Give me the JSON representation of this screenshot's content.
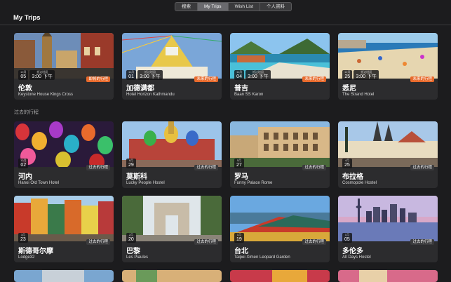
{
  "tabs": [
    {
      "label": "搜索"
    },
    {
      "label": "My Trips",
      "active": true
    },
    {
      "label": "Wish List"
    },
    {
      "label": "个人资料"
    }
  ],
  "page_title": "My Trips",
  "past_section_label": "过去的行程",
  "accent_color": "#e86a2c",
  "upcoming": [
    {
      "city": "伦敦",
      "hotel": "Keystone House Kings Cross",
      "month": "10月",
      "day": "05",
      "time_label": "抵达时间",
      "time": "3:00 下午",
      "badge": "即将的行程",
      "photo": "london-street"
    },
    {
      "city": "加德满都",
      "hotel": "Hotel Horizon Kathmandu",
      "month": "11月",
      "day": "01",
      "time_label": "抵达时间",
      "time": "3:00 下午",
      "badge": "未来的行程",
      "photo": "kathmandu-stupa"
    },
    {
      "city": "普吉",
      "hotel": "Baan SS Karon",
      "month": "11月",
      "day": "04",
      "time_label": "抵达时间",
      "time": "3:00 下午",
      "badge": "未来的行程",
      "photo": "phuket-pool"
    },
    {
      "city": "悉尼",
      "hotel": "The Strand Hotel",
      "month": "12月",
      "day": "25",
      "time_label": "抵达时间",
      "time": "3:00 下午",
      "badge": "未来的行程",
      "photo": "sydney-beach"
    }
  ],
  "past": [
    {
      "city": "河内",
      "hotel": "Hanoi Old Town Hotel",
      "month": "10月",
      "day": "02",
      "badge": "过去的行程",
      "photo": "hanoi-lanterns"
    },
    {
      "city": "莫斯科",
      "hotel": "Lucky People Hostel",
      "month": "6月",
      "day": "29",
      "badge": "过去的行程",
      "photo": "moscow-kremlin"
    },
    {
      "city": "罗马",
      "hotel": "Funny Palace Rome",
      "month": "5月",
      "day": "27",
      "badge": "过去的行程",
      "photo": "rome-colosseum"
    },
    {
      "city": "布拉格",
      "hotel": "Cosmopole Hostel",
      "month": "4月",
      "day": "25",
      "badge": "过去的行程",
      "photo": "prague-oldtown"
    },
    {
      "city": "斯德哥尔摩",
      "hotel": "Lodge32",
      "month": "3月",
      "day": "23",
      "badge": "过去的行程",
      "photo": "stockholm-houses"
    },
    {
      "city": "巴黎",
      "hotel": "Les Piaules",
      "month": "2月",
      "day": "20",
      "badge": "过去的行程",
      "photo": "paris-arc"
    },
    {
      "city": "台北",
      "hotel": "Taipei Ximen Leopard Garden",
      "month": "1月",
      "day": "19",
      "badge": "过去的行程",
      "photo": "taipei-temple"
    },
    {
      "city": "多伦多",
      "hotel": "All Days Hostel",
      "month": "1月",
      "day": "05",
      "badge": "过去的行程",
      "photo": "toronto-skyline"
    }
  ]
}
